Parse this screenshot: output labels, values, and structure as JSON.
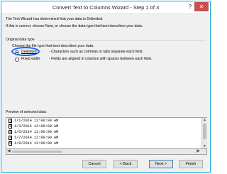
{
  "window": {
    "title": "Convert Text to Columns Wizard - Step 1 of 3",
    "help": "?",
    "close": "✕"
  },
  "intro": {
    "line1": "The Text Wizard has determined that your data is Delimited.",
    "line2": "If this is correct, choose Next, or choose the data type that best describes your data."
  },
  "original_data_type": {
    "group_label": "Original data type",
    "prompt": "Choose the file type that best describes your data:",
    "options": [
      {
        "label": "Delimited",
        "description": "- Characters such as commas or tabs separate each field.",
        "selected": true
      },
      {
        "label": "Fixed width",
        "description": "- Fields are aligned in columns with spaces between each field.",
        "selected": false
      }
    ]
  },
  "preview": {
    "label": "Preview of selected data:",
    "rows": [
      {
        "num": "1",
        "text": "1/1/2014  12:00:00  AM"
      },
      {
        "num": "2",
        "text": "1/3/2014  12:00:00  AM"
      },
      {
        "num": "3",
        "text": "1/5/2014  12:00:00  AM"
      },
      {
        "num": "4",
        "text": "1/7/2014  12:00:00  AM"
      },
      {
        "num": "5",
        "text": "1/9/2014  12:00:00  AM"
      }
    ]
  },
  "buttons": {
    "cancel": "Cancel",
    "back": "< Back",
    "next": "Next >",
    "finish": "Finish"
  },
  "colors": {
    "window_border": "#16a3dc",
    "highlight": "#1660ff",
    "close_button": "#c75050"
  }
}
